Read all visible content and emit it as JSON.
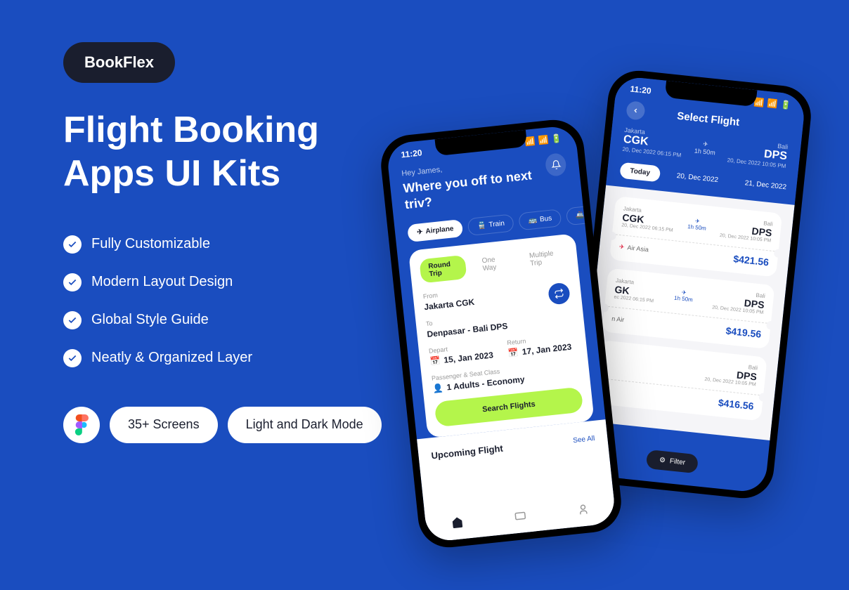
{
  "logo": "BookFlex",
  "title": "Flight Booking Apps UI Kits",
  "features": [
    "Fully Customizable",
    "Modern Layout Design",
    "Global Style Guide",
    "Neatly & Organized Layer"
  ],
  "badges": {
    "screens": "35+ Screens",
    "mode": "Light and Dark Mode"
  },
  "phone1": {
    "time": "11:20",
    "hey": "Hey James,",
    "headline": "Where you off to next triv?",
    "tabs": {
      "airplane": "Airplane",
      "train": "Train",
      "bus": "Bus",
      "ship": "SI"
    },
    "trip": {
      "round": "Round Trip",
      "oneway": "One Way",
      "multi": "Multiple Trip"
    },
    "from_label": "From",
    "from": "Jakarta CGK",
    "to_label": "To",
    "to": "Denpasar - Bali DPS",
    "depart_label": "Depart",
    "depart": "15, Jan 2023",
    "return_label": "Return",
    "return": "17, Jan 2023",
    "pax_label": "Passenger & Seat Class",
    "pax": "1 Adults - Economy",
    "search": "Search Flights",
    "upcoming": "Upcoming Flight",
    "seeall": "See All"
  },
  "phone2": {
    "time": "11:20",
    "title": "Select Flight",
    "from_city": "Jakarta",
    "from_code": "CGK",
    "from_time": "20, Dec 2022 06:15 PM",
    "duration": "1h 50m",
    "to_city": "Bali",
    "to_code": "DPS",
    "to_time": "20, Dec 2022 10:05 PM",
    "dates": {
      "today": "Today",
      "d1": "20, Dec 2022",
      "d2": "21, Dec 2022"
    },
    "flights": [
      {
        "from_city": "Jakarta",
        "from": "CGK",
        "ft": "20, Dec 2022 06:15 PM",
        "dur": "1h 50m",
        "to_city": "Bali",
        "to": "DPS",
        "tt": "20, Dec 2022 10:05 PM",
        "airline": "Air Asia",
        "price": "$421.56"
      },
      {
        "from_city": "Jakarta",
        "from": "GK",
        "ft": "ec 2022 06:15 PM",
        "dur": "1h 50m",
        "to_city": "Bali",
        "to": "DPS",
        "tt": "20, Dec 2022 10:05 PM",
        "airline": "n Air",
        "price": "$419.56"
      },
      {
        "from_city": "",
        "from": "",
        "ft": "",
        "dur": "",
        "to_city": "Bali",
        "to": "DPS",
        "tt": "20, Dec 2022 10:05 PM",
        "airline": "",
        "price": "$416.56"
      }
    ],
    "filter": "Filter"
  }
}
